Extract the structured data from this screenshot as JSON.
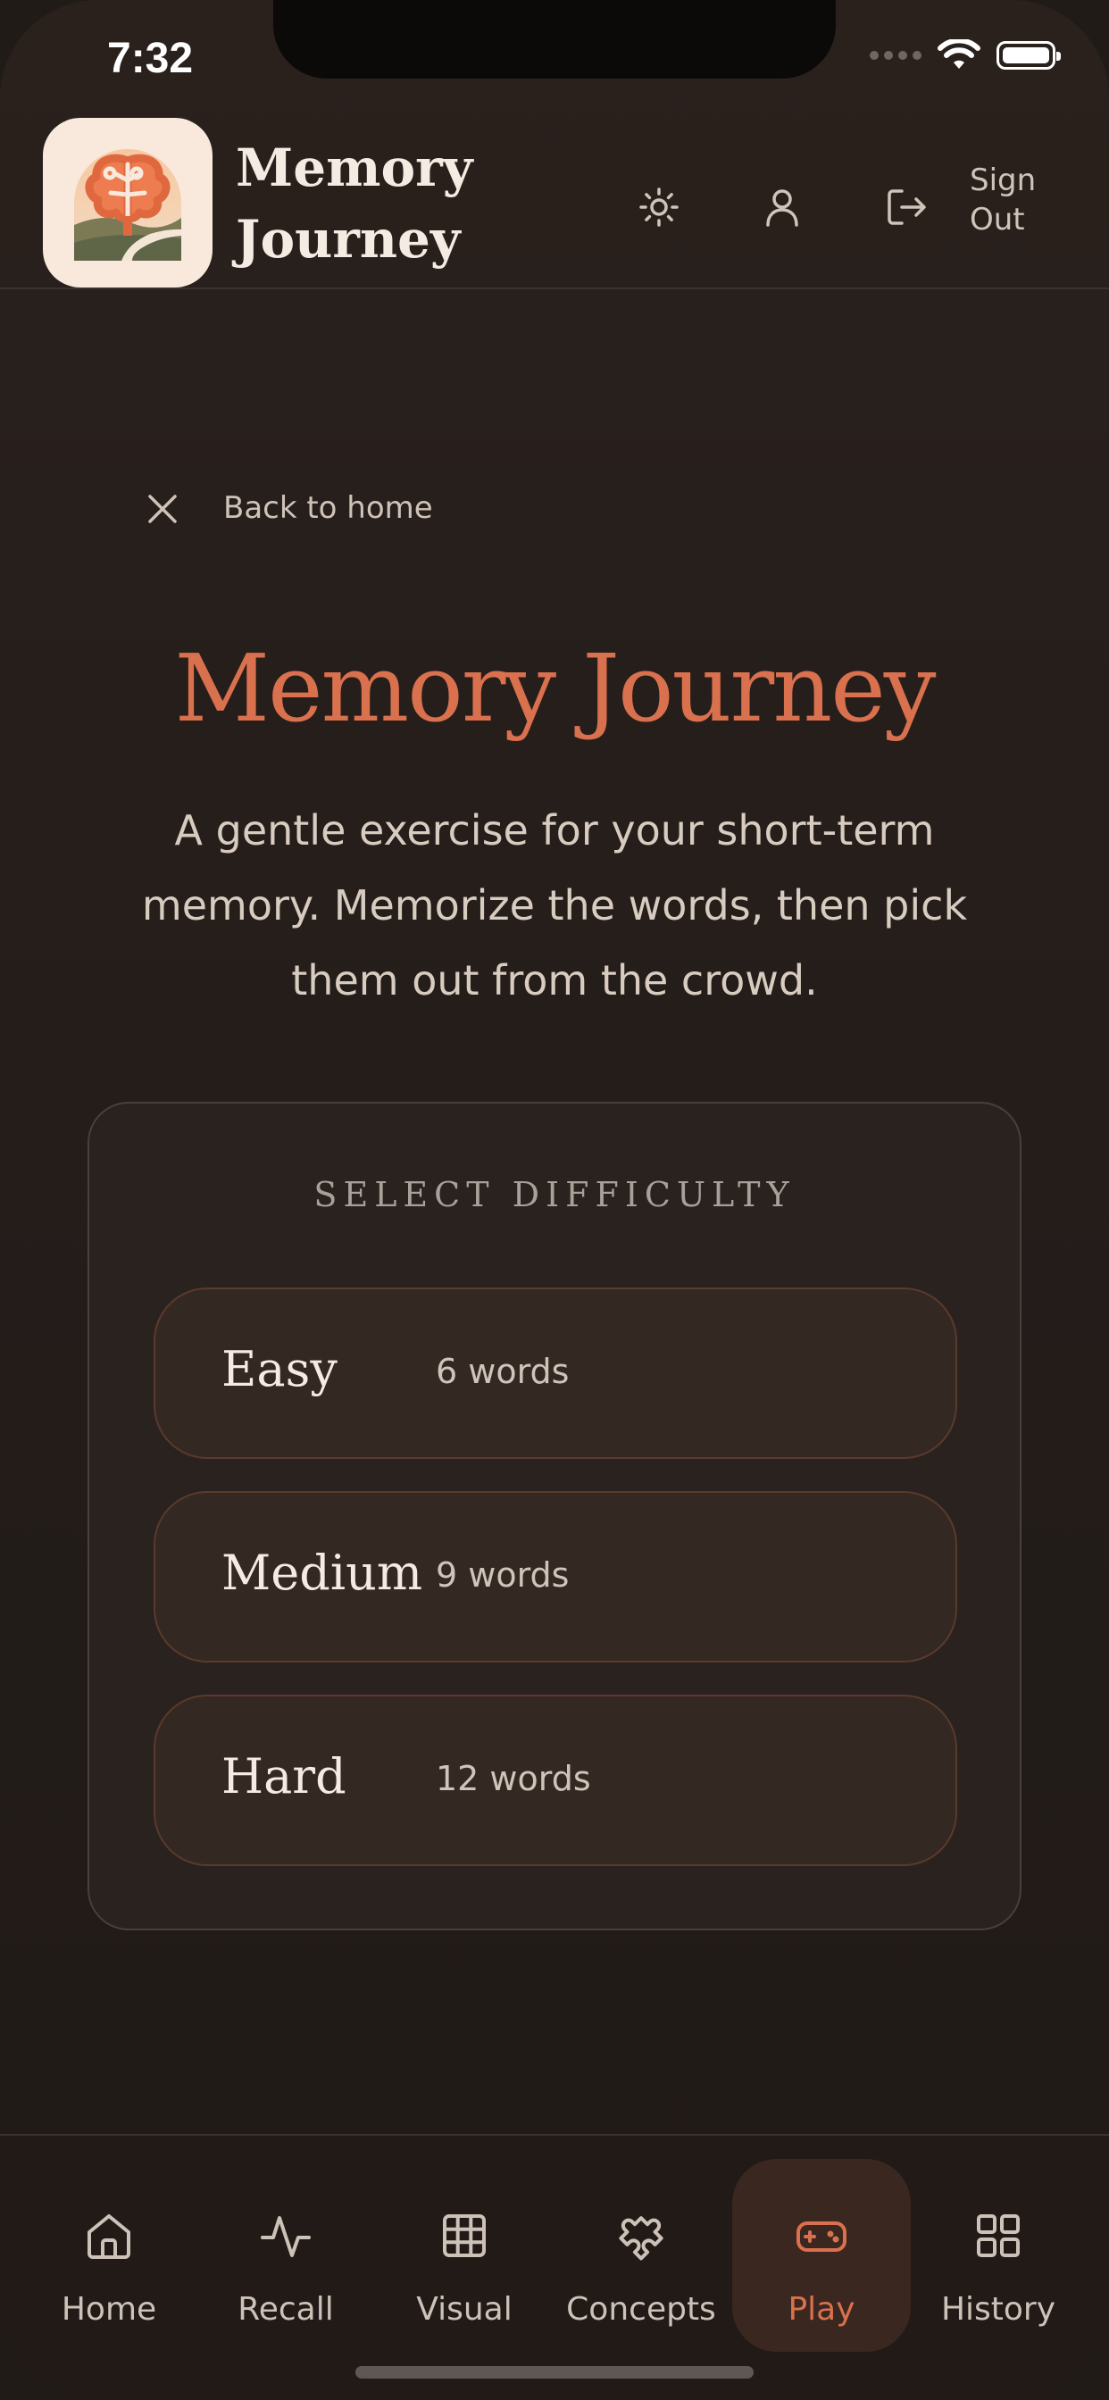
{
  "status": {
    "time": "7:32"
  },
  "header": {
    "app_name": "Memory Journey",
    "sign_out_label": "Sign Out"
  },
  "back_link": {
    "label": "Back to home"
  },
  "main": {
    "title": "Memory Journey",
    "subtitle": "A gentle exercise for your short-term memory. Memorize the words, then pick them out from the crowd."
  },
  "difficulty": {
    "heading": "SELECT DIFFICULTY",
    "options": [
      {
        "name": "Easy",
        "count": "6 words"
      },
      {
        "name": "Medium",
        "count": "9 words"
      },
      {
        "name": "Hard",
        "count": "12 words"
      }
    ]
  },
  "nav": {
    "active": "Play",
    "items": [
      {
        "label": "Home",
        "icon": "home-icon"
      },
      {
        "label": "Recall",
        "icon": "pulse-icon"
      },
      {
        "label": "Visual",
        "icon": "grid-icon"
      },
      {
        "label": "Concepts",
        "icon": "puzzle-icon"
      },
      {
        "label": "Play",
        "icon": "gamepad-icon"
      },
      {
        "label": "History",
        "icon": "dashboard-icon"
      }
    ]
  },
  "colors": {
    "accent": "#d9704e",
    "background": "#241d1a",
    "text": "#f4ebe2"
  }
}
